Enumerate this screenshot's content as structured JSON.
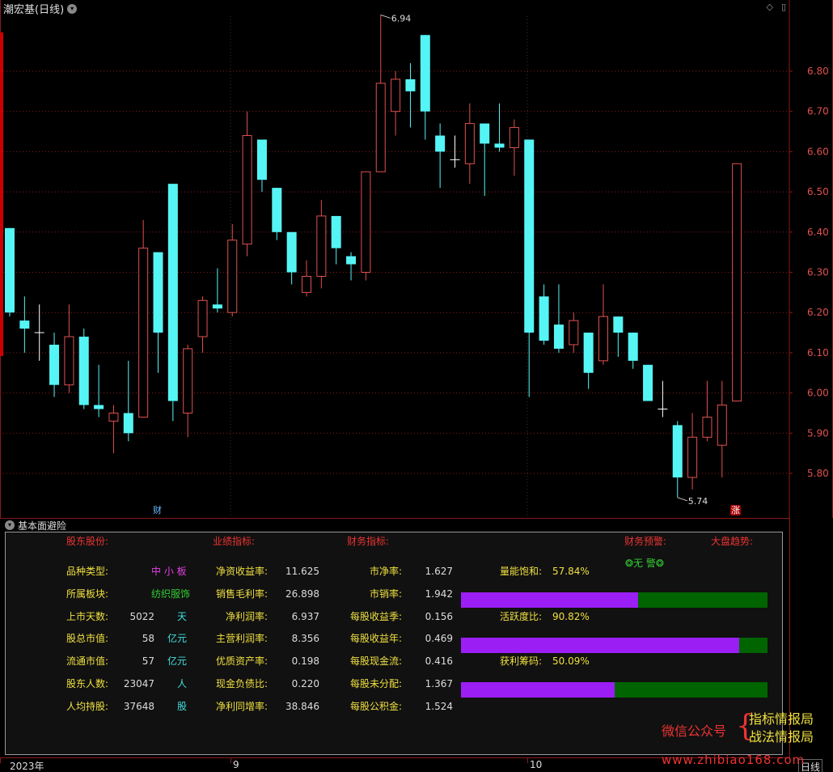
{
  "header": {
    "title": "潮宏基(日线)",
    "window_controls": [
      "◇",
      "▯"
    ]
  },
  "price_axis": {
    "labels": [
      "6.80",
      "6.70",
      "6.60",
      "6.50",
      "6.40",
      "6.30",
      "6.20",
      "6.10",
      "6.00",
      "5.90",
      "5.80"
    ],
    "min": 5.72,
    "max": 6.96
  },
  "annotations": {
    "high": "6.94",
    "low": "5.74"
  },
  "badges": {
    "cai": "财",
    "zhang": "涨"
  },
  "colors": {
    "up": "#e05050",
    "down": "#55f5f5",
    "grid": "#8a1a1a",
    "bar_fill": "#9b1ef5",
    "bar_bg": "#006400"
  },
  "chart_data": {
    "type": "candlestick",
    "candles": [
      {
        "o": 6.41,
        "h": 6.41,
        "l": 6.19,
        "c": 6.2
      },
      {
        "o": 6.18,
        "h": 6.24,
        "l": 6.1,
        "c": 6.16
      },
      {
        "o": 6.15,
        "h": 6.22,
        "l": 6.08,
        "c": 6.15
      },
      {
        "o": 6.12,
        "h": 6.15,
        "l": 5.99,
        "c": 6.02
      },
      {
        "o": 6.02,
        "h": 6.22,
        "l": 6.0,
        "c": 6.14
      },
      {
        "o": 6.14,
        "h": 6.16,
        "l": 5.96,
        "c": 5.97
      },
      {
        "o": 5.97,
        "h": 6.07,
        "l": 5.94,
        "c": 5.96
      },
      {
        "o": 5.93,
        "h": 5.97,
        "l": 5.85,
        "c": 5.95
      },
      {
        "o": 5.95,
        "h": 6.08,
        "l": 5.88,
        "c": 5.9
      },
      {
        "o": 5.94,
        "h": 6.43,
        "l": 5.94,
        "c": 6.36
      },
      {
        "o": 6.35,
        "h": 6.35,
        "l": 6.05,
        "c": 6.15
      },
      {
        "o": 6.52,
        "h": 6.52,
        "l": 5.93,
        "c": 5.98
      },
      {
        "o": 5.95,
        "h": 6.12,
        "l": 5.89,
        "c": 6.11
      },
      {
        "o": 6.14,
        "h": 6.24,
        "l": 6.1,
        "c": 6.23
      },
      {
        "o": 6.22,
        "h": 6.31,
        "l": 6.2,
        "c": 6.21
      },
      {
        "o": 6.2,
        "h": 6.42,
        "l": 6.19,
        "c": 6.38
      },
      {
        "o": 6.37,
        "h": 6.7,
        "l": 6.34,
        "c": 6.64
      },
      {
        "o": 6.63,
        "h": 6.63,
        "l": 6.5,
        "c": 6.53
      },
      {
        "o": 6.51,
        "h": 6.51,
        "l": 6.38,
        "c": 6.4
      },
      {
        "o": 6.4,
        "h": 6.4,
        "l": 6.27,
        "c": 6.3
      },
      {
        "o": 6.25,
        "h": 6.33,
        "l": 6.24,
        "c": 6.29
      },
      {
        "o": 6.29,
        "h": 6.48,
        "l": 6.26,
        "c": 6.44
      },
      {
        "o": 6.44,
        "h": 6.44,
        "l": 6.32,
        "c": 6.36
      },
      {
        "o": 6.34,
        "h": 6.35,
        "l": 6.28,
        "c": 6.32
      },
      {
        "o": 6.3,
        "h": 6.55,
        "l": 6.28,
        "c": 6.55
      },
      {
        "o": 6.55,
        "h": 6.94,
        "l": 6.55,
        "c": 6.77
      },
      {
        "o": 6.7,
        "h": 6.8,
        "l": 6.64,
        "c": 6.78
      },
      {
        "o": 6.78,
        "h": 6.82,
        "l": 6.66,
        "c": 6.75
      },
      {
        "o": 6.89,
        "h": 6.89,
        "l": 6.63,
        "c": 6.7
      },
      {
        "o": 6.64,
        "h": 6.67,
        "l": 6.51,
        "c": 6.6
      },
      {
        "o": 6.58,
        "h": 6.64,
        "l": 6.56,
        "c": 6.58
      },
      {
        "o": 6.57,
        "h": 6.72,
        "l": 6.52,
        "c": 6.67
      },
      {
        "o": 6.67,
        "h": 6.67,
        "l": 6.49,
        "c": 6.62
      },
      {
        "o": 6.62,
        "h": 6.72,
        "l": 6.6,
        "c": 6.61
      },
      {
        "o": 6.61,
        "h": 6.68,
        "l": 6.54,
        "c": 6.66
      },
      {
        "o": 6.63,
        "h": 6.63,
        "l": 5.99,
        "c": 6.15
      },
      {
        "o": 6.24,
        "h": 6.27,
        "l": 6.12,
        "c": 6.13
      },
      {
        "o": 6.17,
        "h": 6.27,
        "l": 6.1,
        "c": 6.11
      },
      {
        "o": 6.12,
        "h": 6.2,
        "l": 6.1,
        "c": 6.18
      },
      {
        "o": 6.15,
        "h": 6.15,
        "l": 6.01,
        "c": 6.05
      },
      {
        "o": 6.08,
        "h": 6.27,
        "l": 6.07,
        "c": 6.19
      },
      {
        "o": 6.19,
        "h": 6.19,
        "l": 6.09,
        "c": 6.15
      },
      {
        "o": 6.15,
        "h": 6.15,
        "l": 6.06,
        "c": 6.08
      },
      {
        "o": 6.07,
        "h": 6.07,
        "l": 5.98,
        "c": 5.98
      },
      {
        "o": 5.96,
        "h": 6.03,
        "l": 5.94,
        "c": 5.96
      },
      {
        "o": 5.92,
        "h": 5.93,
        "l": 5.74,
        "c": 5.79
      },
      {
        "o": 5.79,
        "h": 5.95,
        "l": 5.76,
        "c": 5.89
      },
      {
        "o": 5.89,
        "h": 6.03,
        "l": 5.88,
        "c": 5.94
      },
      {
        "o": 5.87,
        "h": 6.03,
        "l": 5.79,
        "c": 5.97
      },
      {
        "o": 5.98,
        "h": 6.57,
        "l": 5.98,
        "c": 6.57
      }
    ]
  },
  "panel": {
    "title": "基本面避险",
    "headers": {
      "holder": "股东股份:",
      "perf": "业绩指标:",
      "fin": "财务指标:",
      "warn": "财务预警:",
      "market": "大盘趋势:"
    },
    "warn_status": "❂无 警❂",
    "col1": [
      {
        "label": "品种类型:",
        "value": "中 小 板",
        "unit": ""
      },
      {
        "label": "所属板块:",
        "value": "纺织服饰",
        "unit": ""
      },
      {
        "label": "上市天数:",
        "value": "5022",
        "unit": "天"
      },
      {
        "label": "股总市值:",
        "value": "58",
        "unit": "亿元"
      },
      {
        "label": "流通市值:",
        "value": "57",
        "unit": "亿元"
      },
      {
        "label": "股东人数:",
        "value": "23047",
        "unit": "人"
      },
      {
        "label": "人均持股:",
        "value": "37648",
        "unit": "股"
      }
    ],
    "col2": [
      {
        "label": "净资收益率:",
        "value": "11.625"
      },
      {
        "label": "销售毛利率:",
        "value": "26.898"
      },
      {
        "label": "净利润率:",
        "value": "6.937"
      },
      {
        "label": "主营利润率:",
        "value": "8.356"
      },
      {
        "label": "优质资产率:",
        "value": "0.198"
      },
      {
        "label": "现金负债比:",
        "value": "0.220"
      },
      {
        "label": "净利同增率:",
        "value": "38.846"
      }
    ],
    "col3": [
      {
        "label": "市净率:",
        "value": "1.627"
      },
      {
        "label": "市销率:",
        "value": "1.942"
      },
      {
        "label": "每股收益季:",
        "value": "0.156"
      },
      {
        "label": "每股收益年:",
        "value": "0.469"
      },
      {
        "label": "每股现金流:",
        "value": "0.416"
      },
      {
        "label": "每股未分配:",
        "value": "1.367"
      },
      {
        "label": "每股公积金:",
        "value": "1.524"
      }
    ],
    "meters": [
      {
        "label": "量能饱和:",
        "value": "57.84%",
        "fraction": 0.5784
      },
      {
        "label": "活跃度比:",
        "value": "90.82%",
        "fraction": 0.9082
      },
      {
        "label": "获利筹码:",
        "value": "50.09%",
        "fraction": 0.5009
      }
    ]
  },
  "time_axis": {
    "labels": [
      "2023年",
      "9",
      "10"
    ]
  },
  "period": "日线",
  "watermark": {
    "line1": "微信公众号",
    "brace": "{",
    "line2a": "指标情报局",
    "line2b": "战法情报局",
    "site": "www.zhibiao168.com"
  }
}
